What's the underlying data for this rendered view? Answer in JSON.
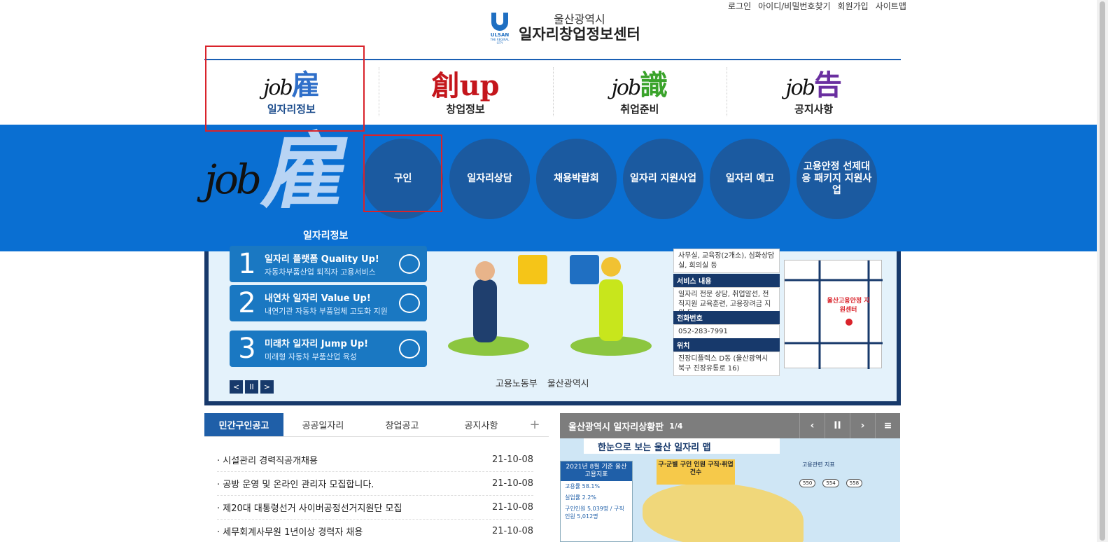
{
  "util_links": [
    "로그인",
    "아이디/비밀번호찾기",
    "회원가입",
    "사이트맵"
  ],
  "logo": {
    "mark_name": "ULSAN",
    "mark_sub": "THE REGINAL CITY",
    "city": "울산광역시",
    "center": "일자리창업정보센터"
  },
  "main_nav": [
    {
      "job": "job",
      "han": "雇",
      "han_color": "#2f6fc9",
      "label": "일자리정보"
    },
    {
      "job": "",
      "han": "創up",
      "han_color": "#c4161c",
      "label": "창업정보"
    },
    {
      "job": "job",
      "han": "識",
      "han_color": "#3aa32b",
      "label": "취업준비"
    },
    {
      "job": "job",
      "han": "告",
      "han_color": "#6a2fa0",
      "label": "공지사항"
    }
  ],
  "dropdown": {
    "job": "job",
    "han": "雇",
    "label": "일자리정보",
    "items": [
      "구인",
      "일자리상담",
      "채용박람회",
      "일자리 지원사업",
      "일자리 예고",
      "고용안정 선제대응 패키지 지원사업"
    ]
  },
  "banner": {
    "programs": [
      {
        "num": "1",
        "title": "일자리 플랫폼 Quality Up!",
        "desc": "자동차부품산업 퇴직자 고용서비스"
      },
      {
        "num": "2",
        "title": "내연차 일자리 Value Up!",
        "desc": "내연기관 자동차 부품업체 고도화 지원"
      },
      {
        "num": "3",
        "title": "미래차 일자리 Jump Up!",
        "desc": "미래형 자동차 부품산업 육성"
      }
    ],
    "controls": [
      "<",
      "II",
      ">"
    ],
    "orgs": [
      "고용노동부",
      "울산광역시"
    ],
    "info": [
      {
        "head": "",
        "body": "사무실, 교육장(2개소), 심화상담실, 회의실 등"
      },
      {
        "head": "서비스 내용",
        "body": "일자리 전문 상담, 취업알선, 전직지원 교육훈련, 고용장려금 지원 등"
      },
      {
        "head": "전화번호",
        "body": "052-283-7991"
      },
      {
        "head": "위치",
        "body": "진장디플렉스 D동 (울산광역시 북구 진장유통로 16)"
      }
    ],
    "map_label": "울산고용안정 지원센터"
  },
  "board": {
    "tabs": [
      "민간구인공고",
      "공공일자리",
      "창업공고",
      "공지사항"
    ],
    "plus": "+",
    "rows": [
      {
        "title": "시설관리 경력직공개채용",
        "date": "21-10-08"
      },
      {
        "title": "공방 운영 및 온라인 관리자 모집합니다.",
        "date": "21-10-08"
      },
      {
        "title": "제20대 대통령선거 사이버공정선거지원단 모집",
        "date": "21-10-08"
      },
      {
        "title": "세무회계사무원 1년이상 경력자 채용",
        "date": "21-10-08"
      }
    ]
  },
  "status": {
    "title": "울산광역시 일자리상황판",
    "page": "1/4",
    "buttons": [
      "‹",
      "II",
      "›",
      "≡"
    ],
    "pill": "한눈으로 보는 울산 일자리 맵",
    "panel_head": "2021년 8월 기준 울산 고용지표",
    "panel_rows": [
      "고용률 58.1%",
      "실업률 2.2%",
      "구인인원 5,039명 / 구직인원 5,012명"
    ],
    "callout": "구·군별 구인 인원 구직·취업 건수",
    "legend": "고용관련 지표",
    "dots": [
      "550",
      "554",
      "558"
    ]
  }
}
